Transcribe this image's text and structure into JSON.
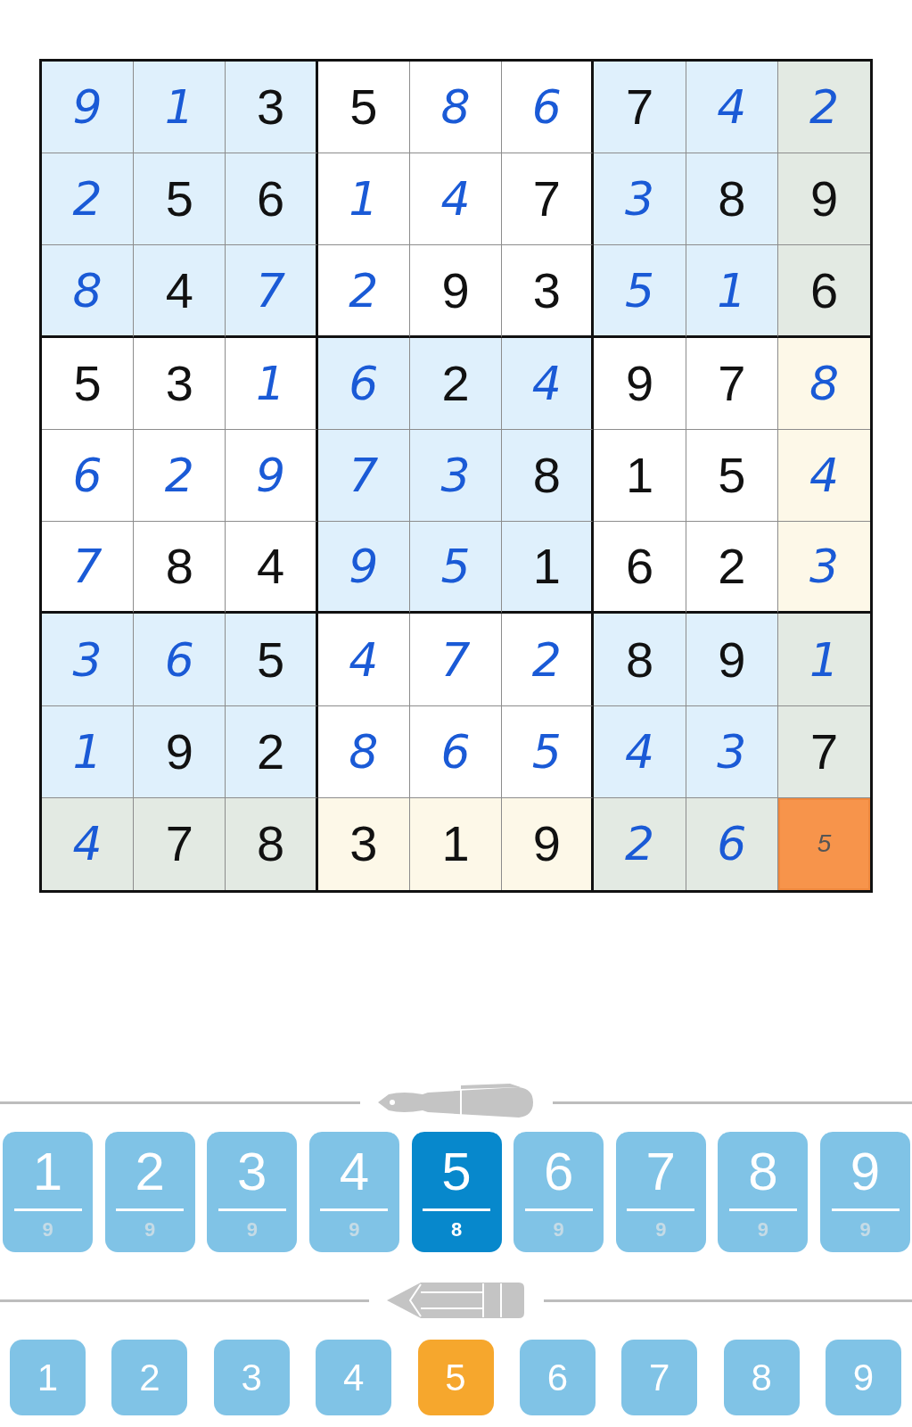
{
  "board": {
    "rows": [
      {
        "cells": [
          {
            "value": "9",
            "kind": "entered",
            "color": "#dff0fc",
            "selected": false
          },
          {
            "value": "1",
            "kind": "entered",
            "color": "#dff0fc",
            "selected": false
          },
          {
            "value": "3",
            "kind": "given",
            "color": "#dff0fc",
            "selected": false
          },
          {
            "value": "5",
            "kind": "given",
            "color": "#ffffff",
            "selected": false
          },
          {
            "value": "8",
            "kind": "entered",
            "color": "#ffffff",
            "selected": false
          },
          {
            "value": "6",
            "kind": "entered",
            "color": "#ffffff",
            "selected": false
          },
          {
            "value": "7",
            "kind": "given",
            "color": "#dff0fc",
            "selected": false
          },
          {
            "value": "4",
            "kind": "entered",
            "color": "#dff0fc",
            "selected": false
          },
          {
            "value": "2",
            "kind": "entered",
            "color": "#e3eae3",
            "selected": false
          }
        ]
      },
      {
        "cells": [
          {
            "value": "2",
            "kind": "entered",
            "color": "#dff0fc",
            "selected": false
          },
          {
            "value": "5",
            "kind": "given",
            "color": "#dff0fc",
            "selected": false
          },
          {
            "value": "6",
            "kind": "given",
            "color": "#dff0fc",
            "selected": false
          },
          {
            "value": "1",
            "kind": "entered",
            "color": "#ffffff",
            "selected": false
          },
          {
            "value": "4",
            "kind": "entered",
            "color": "#ffffff",
            "selected": false
          },
          {
            "value": "7",
            "kind": "given",
            "color": "#ffffff",
            "selected": false
          },
          {
            "value": "3",
            "kind": "entered",
            "color": "#dff0fc",
            "selected": false
          },
          {
            "value": "8",
            "kind": "given",
            "color": "#dff0fc",
            "selected": false
          },
          {
            "value": "9",
            "kind": "given",
            "color": "#e3eae3",
            "selected": false
          }
        ]
      },
      {
        "cells": [
          {
            "value": "8",
            "kind": "entered",
            "color": "#dff0fc",
            "selected": false
          },
          {
            "value": "4",
            "kind": "given",
            "color": "#dff0fc",
            "selected": false
          },
          {
            "value": "7",
            "kind": "entered",
            "color": "#dff0fc",
            "selected": false
          },
          {
            "value": "2",
            "kind": "entered",
            "color": "#ffffff",
            "selected": false
          },
          {
            "value": "9",
            "kind": "given",
            "color": "#ffffff",
            "selected": false
          },
          {
            "value": "3",
            "kind": "given",
            "color": "#ffffff",
            "selected": false
          },
          {
            "value": "5",
            "kind": "entered",
            "color": "#dff0fc",
            "selected": false
          },
          {
            "value": "1",
            "kind": "entered",
            "color": "#dff0fc",
            "selected": false
          },
          {
            "value": "6",
            "kind": "given",
            "color": "#e3eae3",
            "selected": false
          }
        ]
      },
      {
        "cells": [
          {
            "value": "5",
            "kind": "given",
            "color": "#ffffff",
            "selected": false
          },
          {
            "value": "3",
            "kind": "given",
            "color": "#ffffff",
            "selected": false
          },
          {
            "value": "1",
            "kind": "entered",
            "color": "#ffffff",
            "selected": false
          },
          {
            "value": "6",
            "kind": "entered",
            "color": "#dff0fc",
            "selected": false
          },
          {
            "value": "2",
            "kind": "given",
            "color": "#dff0fc",
            "selected": false
          },
          {
            "value": "4",
            "kind": "entered",
            "color": "#dff0fc",
            "selected": false
          },
          {
            "value": "9",
            "kind": "given",
            "color": "#ffffff",
            "selected": false
          },
          {
            "value": "7",
            "kind": "given",
            "color": "#ffffff",
            "selected": false
          },
          {
            "value": "8",
            "kind": "entered",
            "color": "#fdf8e8",
            "selected": false
          }
        ]
      },
      {
        "cells": [
          {
            "value": "6",
            "kind": "entered",
            "color": "#ffffff",
            "selected": false
          },
          {
            "value": "2",
            "kind": "entered",
            "color": "#ffffff",
            "selected": false
          },
          {
            "value": "9",
            "kind": "entered",
            "color": "#ffffff",
            "selected": false
          },
          {
            "value": "7",
            "kind": "entered",
            "color": "#dff0fc",
            "selected": false
          },
          {
            "value": "3",
            "kind": "entered",
            "color": "#dff0fc",
            "selected": false
          },
          {
            "value": "8",
            "kind": "given",
            "color": "#dff0fc",
            "selected": false
          },
          {
            "value": "1",
            "kind": "given",
            "color": "#ffffff",
            "selected": false
          },
          {
            "value": "5",
            "kind": "given",
            "color": "#ffffff",
            "selected": false
          },
          {
            "value": "4",
            "kind": "entered",
            "color": "#fdf8e8",
            "selected": false
          }
        ]
      },
      {
        "cells": [
          {
            "value": "7",
            "kind": "entered",
            "color": "#ffffff",
            "selected": false
          },
          {
            "value": "8",
            "kind": "given",
            "color": "#ffffff",
            "selected": false
          },
          {
            "value": "4",
            "kind": "given",
            "color": "#ffffff",
            "selected": false
          },
          {
            "value": "9",
            "kind": "entered",
            "color": "#dff0fc",
            "selected": false
          },
          {
            "value": "5",
            "kind": "entered",
            "color": "#dff0fc",
            "selected": false
          },
          {
            "value": "1",
            "kind": "given",
            "color": "#dff0fc",
            "selected": false
          },
          {
            "value": "6",
            "kind": "given",
            "color": "#ffffff",
            "selected": false
          },
          {
            "value": "2",
            "kind": "given",
            "color": "#ffffff",
            "selected": false
          },
          {
            "value": "3",
            "kind": "entered",
            "color": "#fdf8e8",
            "selected": false
          }
        ]
      },
      {
        "cells": [
          {
            "value": "3",
            "kind": "entered",
            "color": "#dff0fc",
            "selected": false
          },
          {
            "value": "6",
            "kind": "entered",
            "color": "#dff0fc",
            "selected": false
          },
          {
            "value": "5",
            "kind": "given",
            "color": "#dff0fc",
            "selected": false
          },
          {
            "value": "4",
            "kind": "entered",
            "color": "#ffffff",
            "selected": false
          },
          {
            "value": "7",
            "kind": "entered",
            "color": "#ffffff",
            "selected": false
          },
          {
            "value": "2",
            "kind": "entered",
            "color": "#ffffff",
            "selected": false
          },
          {
            "value": "8",
            "kind": "given",
            "color": "#dff0fc",
            "selected": false
          },
          {
            "value": "9",
            "kind": "given",
            "color": "#dff0fc",
            "selected": false
          },
          {
            "value": "1",
            "kind": "entered",
            "color": "#e3eae3",
            "selected": false
          }
        ]
      },
      {
        "cells": [
          {
            "value": "1",
            "kind": "entered",
            "color": "#dff0fc",
            "selected": false
          },
          {
            "value": "9",
            "kind": "given",
            "color": "#dff0fc",
            "selected": false
          },
          {
            "value": "2",
            "kind": "given",
            "color": "#dff0fc",
            "selected": false
          },
          {
            "value": "8",
            "kind": "entered",
            "color": "#ffffff",
            "selected": false
          },
          {
            "value": "6",
            "kind": "entered",
            "color": "#ffffff",
            "selected": false
          },
          {
            "value": "5",
            "kind": "entered",
            "color": "#ffffff",
            "selected": false
          },
          {
            "value": "4",
            "kind": "entered",
            "color": "#dff0fc",
            "selected": false
          },
          {
            "value": "3",
            "kind": "entered",
            "color": "#dff0fc",
            "selected": false
          },
          {
            "value": "7",
            "kind": "given",
            "color": "#e3eae3",
            "selected": false
          }
        ]
      },
      {
        "cells": [
          {
            "value": "4",
            "kind": "entered",
            "color": "#e3eae3",
            "selected": false
          },
          {
            "value": "7",
            "kind": "given",
            "color": "#e3eae3",
            "selected": false
          },
          {
            "value": "8",
            "kind": "given",
            "color": "#e3eae3",
            "selected": false
          },
          {
            "value": "3",
            "kind": "given",
            "color": "#fdf8e8",
            "selected": false
          },
          {
            "value": "1",
            "kind": "given",
            "color": "#fdf8e8",
            "selected": false
          },
          {
            "value": "9",
            "kind": "given",
            "color": "#fdf8e8",
            "selected": false
          },
          {
            "value": "2",
            "kind": "entered",
            "color": "#e3eae3",
            "selected": false
          },
          {
            "value": "6",
            "kind": "entered",
            "color": "#e3eae3",
            "selected": false
          },
          {
            "value": "5",
            "kind": "note",
            "color": "#f7944b",
            "selected": true
          }
        ]
      }
    ]
  },
  "pen_keys": [
    {
      "digit": "1",
      "count": "9",
      "selected": false
    },
    {
      "digit": "2",
      "count": "9",
      "selected": false
    },
    {
      "digit": "3",
      "count": "9",
      "selected": false
    },
    {
      "digit": "4",
      "count": "9",
      "selected": false
    },
    {
      "digit": "5",
      "count": "8",
      "selected": true
    },
    {
      "digit": "6",
      "count": "9",
      "selected": false
    },
    {
      "digit": "7",
      "count": "9",
      "selected": false
    },
    {
      "digit": "8",
      "count": "9",
      "selected": false
    },
    {
      "digit": "9",
      "count": "9",
      "selected": false
    }
  ],
  "pencil_keys": [
    {
      "digit": "1",
      "selected": false
    },
    {
      "digit": "2",
      "selected": false
    },
    {
      "digit": "3",
      "selected": false
    },
    {
      "digit": "4",
      "selected": false
    },
    {
      "digit": "5",
      "selected": true
    },
    {
      "digit": "6",
      "selected": false
    },
    {
      "digit": "7",
      "selected": false
    },
    {
      "digit": "8",
      "selected": false
    },
    {
      "digit": "9",
      "selected": false
    }
  ]
}
